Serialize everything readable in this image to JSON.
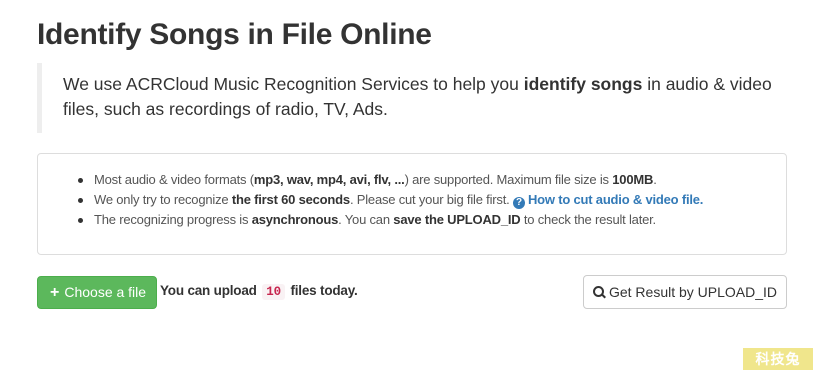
{
  "page": {
    "title": "Identify Songs in File Online"
  },
  "intro": {
    "text_before": "We use ACRCloud Music Recognition Services to help you ",
    "bold": "identify songs",
    "text_after": " in audio & video files, such as recordings of radio, TV, Ads."
  },
  "info": {
    "formats": {
      "t1": "Most audio & video formats (",
      "formats_bold": "mp3, wav, mp4, avi, flv, ...",
      "t2": ") are supported. Maximum file size is ",
      "size_bold": "100MB",
      "t3": "."
    },
    "recognize": {
      "t1": "We only try to recognize ",
      "bold": "the first 60 seconds",
      "t2": ". Please cut your big file first. ",
      "help_icon": "question-circle-icon",
      "help_glyph": "?",
      "link": "How to cut audio & video file."
    },
    "async": {
      "t1": "The recognizing progress is ",
      "bold1": "asynchronous",
      "t2": ". You can ",
      "bold2": "save the UPLOAD_ID",
      "t3": " to check the result later."
    }
  },
  "actions": {
    "choose_icon": "plus-icon",
    "choose_glyph": "+",
    "choose_label": "Choose a file",
    "upload_note_before": "You can upload",
    "upload_count": "10",
    "upload_note_after": "files today.",
    "result_icon": "search-icon",
    "result_label": "Get Result by UPLOAD_ID"
  },
  "watermark": {
    "text": "科技兔"
  },
  "colors": {
    "success_button": "#5cb85c",
    "link": "#337ab7",
    "code_text": "#c7254e",
    "code_bg": "#f9f2f4",
    "watermark_bg": "#f0e68c"
  }
}
